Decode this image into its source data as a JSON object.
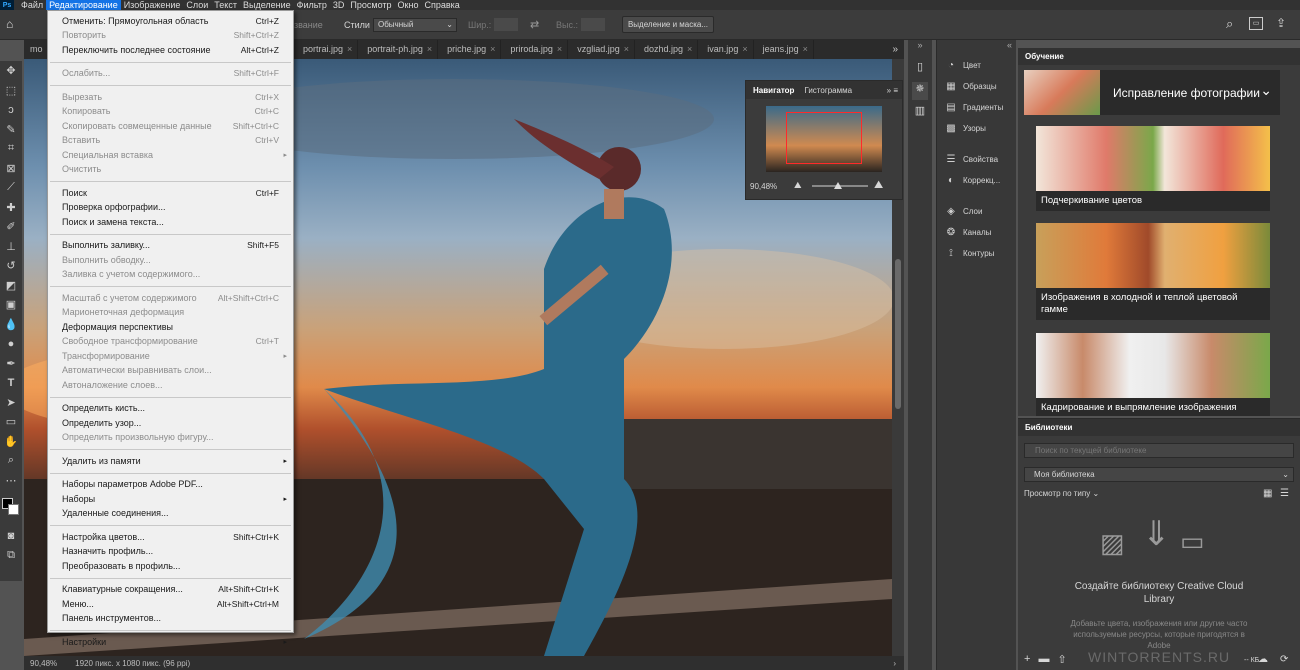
{
  "menubar": {
    "logo": "Ps",
    "items": [
      "Файл",
      "Редактирование",
      "Изображение",
      "Слои",
      "Текст",
      "Выделение",
      "Фильтр",
      "3D",
      "Просмотр",
      "Окно",
      "Справка"
    ],
    "active_index": 1
  },
  "options": {
    "partial_label": "звание",
    "style_label": "Стили",
    "style_value": "Обычный",
    "width_label": "Шир.:",
    "height_label": "Выс.:",
    "select_mask_button": "Выделение и маска..."
  },
  "tabs": {
    "first_partial": "mo",
    "items": [
      "portrai.jpg",
      "portrait-ph.jpg",
      "priche.jpg",
      "priroda.jpg",
      "vzgliad.jpg",
      "dozhd.jpg",
      "ivan.jpg",
      "jeans.jpg"
    ]
  },
  "edit_menu": [
    {
      "label": "Отменить: Прямоугольная область",
      "shortcut": "Ctrl+Z",
      "disabled": false
    },
    {
      "label": "Повторить",
      "shortcut": "Shift+Ctrl+Z",
      "disabled": true
    },
    {
      "label": "Переключить последнее состояние",
      "shortcut": "Alt+Ctrl+Z",
      "disabled": false
    },
    {
      "sep": true
    },
    {
      "label": "Ослабить...",
      "shortcut": "Shift+Ctrl+F",
      "disabled": true
    },
    {
      "sep": true
    },
    {
      "label": "Вырезать",
      "shortcut": "Ctrl+X",
      "disabled": true
    },
    {
      "label": "Копировать",
      "shortcut": "Ctrl+C",
      "disabled": true
    },
    {
      "label": "Скопировать совмещенные данные",
      "shortcut": "Shift+Ctrl+C",
      "disabled": true
    },
    {
      "label": "Вставить",
      "shortcut": "Ctrl+V",
      "disabled": true
    },
    {
      "label": "Специальная вставка",
      "shortcut": "",
      "disabled": true,
      "submenu": true
    },
    {
      "label": "Очистить",
      "shortcut": "",
      "disabled": true
    },
    {
      "sep": true
    },
    {
      "label": "Поиск",
      "shortcut": "Ctrl+F",
      "disabled": false
    },
    {
      "label": "Проверка орфографии...",
      "shortcut": "",
      "disabled": false
    },
    {
      "label": "Поиск и замена текста...",
      "shortcut": "",
      "disabled": false
    },
    {
      "sep": true
    },
    {
      "label": "Выполнить заливку...",
      "shortcut": "Shift+F5",
      "disabled": false
    },
    {
      "label": "Выполнить обводку...",
      "shortcut": "",
      "disabled": true
    },
    {
      "label": "Заливка с учетом содержимого...",
      "shortcut": "",
      "disabled": true
    },
    {
      "sep": true
    },
    {
      "label": "Масштаб с учетом содержимого",
      "shortcut": "Alt+Shift+Ctrl+C",
      "disabled": true
    },
    {
      "label": "Марионеточная деформация",
      "shortcut": "",
      "disabled": true
    },
    {
      "label": "Деформация перспективы",
      "shortcut": "",
      "disabled": false
    },
    {
      "label": "Свободное трансформирование",
      "shortcut": "Ctrl+T",
      "disabled": true
    },
    {
      "label": "Трансформирование",
      "shortcut": "",
      "disabled": true,
      "submenu": true
    },
    {
      "label": "Автоматически выравнивать слои...",
      "shortcut": "",
      "disabled": true
    },
    {
      "label": "Автоналожение слоев...",
      "shortcut": "",
      "disabled": true
    },
    {
      "sep": true
    },
    {
      "label": "Определить кисть...",
      "shortcut": "",
      "disabled": false
    },
    {
      "label": "Определить узор...",
      "shortcut": "",
      "disabled": false
    },
    {
      "label": "Определить произвольную фигуру...",
      "shortcut": "",
      "disabled": true
    },
    {
      "sep": true
    },
    {
      "label": "Удалить из памяти",
      "shortcut": "",
      "disabled": false,
      "submenu": true
    },
    {
      "sep": true
    },
    {
      "label": "Наборы параметров Adobe PDF...",
      "shortcut": "",
      "disabled": false
    },
    {
      "label": "Наборы",
      "shortcut": "",
      "disabled": false,
      "submenu": true
    },
    {
      "label": "Удаленные соединения...",
      "shortcut": "",
      "disabled": false
    },
    {
      "sep": true
    },
    {
      "label": "Настройка цветов...",
      "shortcut": "Shift+Ctrl+K",
      "disabled": false
    },
    {
      "label": "Назначить профиль...",
      "shortcut": "",
      "disabled": false
    },
    {
      "label": "Преобразовать в профиль...",
      "shortcut": "",
      "disabled": false
    },
    {
      "sep": true
    },
    {
      "label": "Клавиатурные сокращения...",
      "shortcut": "Alt+Shift+Ctrl+K",
      "disabled": false
    },
    {
      "label": "Меню...",
      "shortcut": "Alt+Shift+Ctrl+M",
      "disabled": false
    },
    {
      "label": "Панель инструментов...",
      "shortcut": "",
      "disabled": false
    },
    {
      "sep": true
    },
    {
      "label": "Настройки",
      "shortcut": "",
      "disabled": false,
      "submenu": true
    }
  ],
  "navigator": {
    "tab_active": "Навигатор",
    "tab_other": "Гистограмма",
    "zoom": "90,48%"
  },
  "panel_groups": [
    [
      "Цвет",
      "Образцы",
      "Градиенты",
      "Узоры"
    ],
    [
      "Свойства",
      "Коррекц..."
    ],
    [
      "Слои",
      "Каналы",
      "Контуры"
    ]
  ],
  "learn": {
    "title": "Обучение",
    "banner": "Исправление фотографии",
    "cards": [
      "Подчеркивание цветов",
      "Изображения в холодной и теплой цветовой гамме",
      "Кадрирование и выпрямление изображения"
    ]
  },
  "libraries": {
    "title": "Библиотеки",
    "search_placeholder": "Поиск по текущей библиотеке",
    "library": "Моя библиотека",
    "view_by": "Просмотр по типу",
    "create_title": "Создайте библиотеку Creative Cloud Library",
    "create_desc": "Добавьте цвета, изображения или другие часто используемые ресурсы, которые пригодятся в Adobe",
    "size": "-- КБ",
    "watermark": "WINTORRENTS.RU"
  },
  "status": {
    "zoom": "90,48%",
    "info": "1920 пикс. x 1080 пикс. (96 ppi)"
  }
}
